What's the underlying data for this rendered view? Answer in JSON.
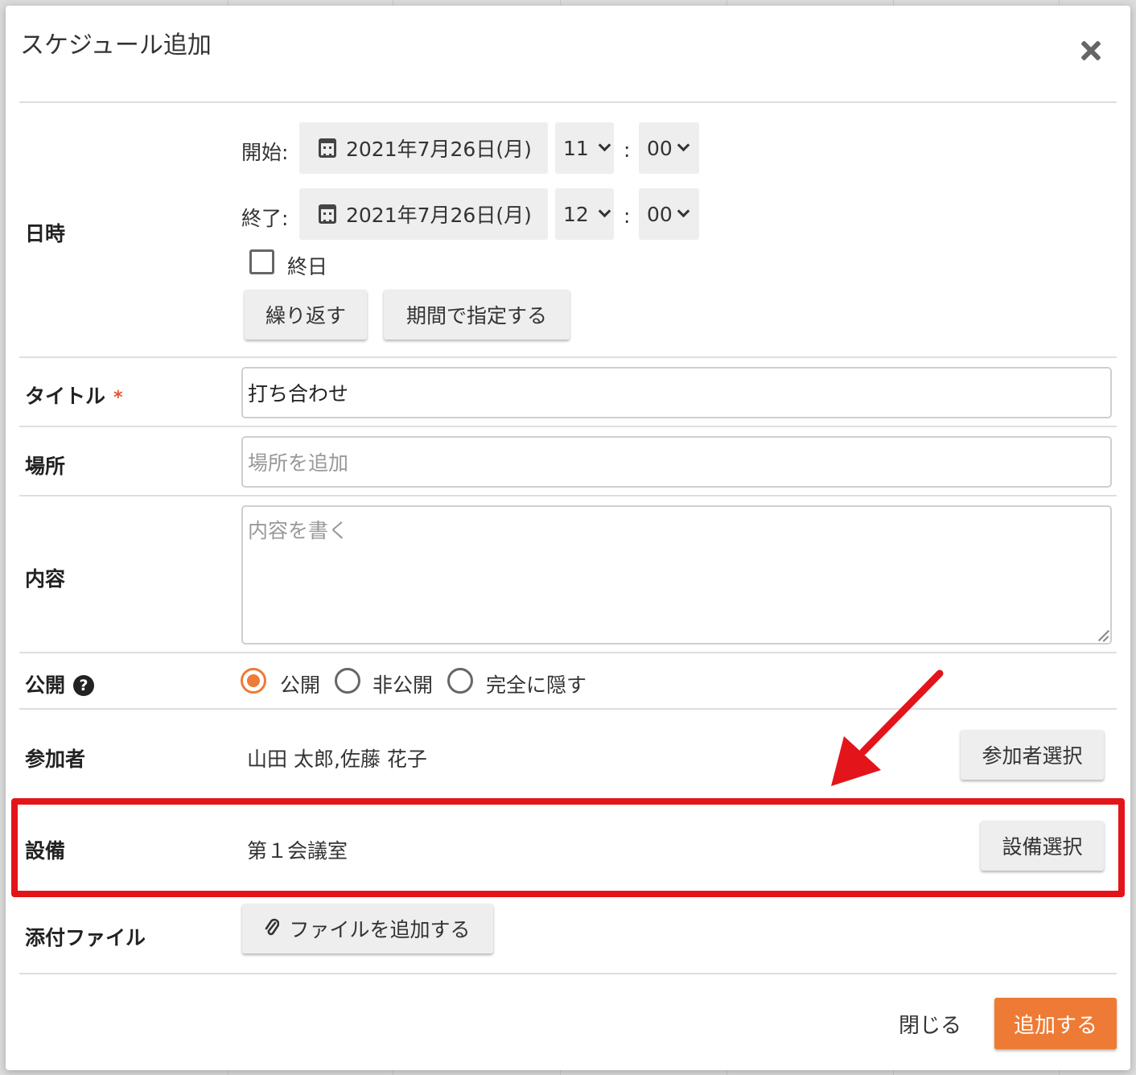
{
  "dialog": {
    "title": "スケジュール追加"
  },
  "datetime": {
    "label": "日時",
    "start_label": "開始:",
    "end_label": "終了:",
    "start_date": "2021年7月26日(月)",
    "start_hour": "11",
    "start_minute": "00",
    "end_date": "2021年7月26日(月)",
    "end_hour": "12",
    "end_minute": "00",
    "colon": ":",
    "all_day_label": "終日",
    "all_day_checked": false,
    "repeat_button": "繰り返す",
    "period_button": "期間で指定する"
  },
  "title_field": {
    "label": "タイトル",
    "required_mark": "*",
    "value": "打ち合わせ"
  },
  "place_field": {
    "label": "場所",
    "placeholder": "場所を追加"
  },
  "content_field": {
    "label": "内容",
    "placeholder": "内容を書く"
  },
  "visibility": {
    "label": "公開",
    "help_icon": "?",
    "options": [
      "公開",
      "非公開",
      "完全に隠す"
    ],
    "selected": "公開"
  },
  "participants": {
    "label": "参加者",
    "value": "山田 太郎,佐藤 花子",
    "button": "参加者選択"
  },
  "equipment": {
    "label": "設備",
    "value": "第１会議室",
    "button": "設備選択"
  },
  "attachment": {
    "label": "添付ファイル",
    "button": "ファイルを追加する"
  },
  "footer": {
    "close_label": "閉じる",
    "submit_label": "追加する"
  },
  "colors": {
    "accent": "#ee7b35",
    "highlight": "#e3141a"
  }
}
